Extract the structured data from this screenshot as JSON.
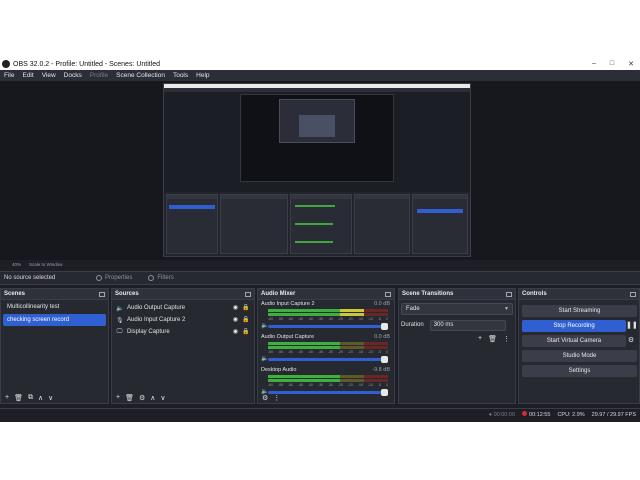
{
  "window": {
    "title": "OBS 32.0.2 - Profile: Untitled - Scenes: Untitled",
    "controls": [
      "–",
      "□",
      "✕"
    ]
  },
  "menu": [
    "File",
    "Edit",
    "View",
    "Docks",
    "Profile",
    "Scene Collection",
    "Tools",
    "Help"
  ],
  "zoom": {
    "percent": "40%",
    "mode": "Scale to Window"
  },
  "source_bar": {
    "no_source": "No source selected",
    "properties": "Properties",
    "filters": "Filters"
  },
  "scenes": {
    "title": "Scenes",
    "items": [
      {
        "label": "Multicollinearity test"
      },
      {
        "label": "checking screen record"
      }
    ],
    "footer": [
      "+",
      "🗑",
      "⧉",
      "∧",
      "∨"
    ]
  },
  "sources": {
    "title": "Sources",
    "items": [
      {
        "label": "Audio Output Capture",
        "icon": "🔈"
      },
      {
        "label": "Audio Input Capture 2",
        "icon": "🎙"
      },
      {
        "label": "Display Capture",
        "icon": "🖵"
      }
    ],
    "footer": [
      "+",
      "🗑",
      "⚙",
      "∧",
      "∨"
    ]
  },
  "mixer": {
    "title": "Audio Mixer",
    "scale": [
      "-60",
      "-55",
      "-50",
      "-45",
      "-40",
      "-35",
      "-30",
      "-25",
      "-20",
      "-15",
      "-10",
      "-5",
      "0"
    ],
    "channels": [
      {
        "name": "Audio Input Capture 2",
        "db": "0.0 dB",
        "level": 0.62
      },
      {
        "name": "Audio Output Capture",
        "db": "0.0 dB",
        "level": 0.6
      },
      {
        "name": "Desktop Audio",
        "db": "-9.8 dB",
        "level": 0.6
      }
    ],
    "footer": [
      "⚙",
      "⋮"
    ]
  },
  "transitions": {
    "title": "Scene Transitions",
    "selected": "Fade",
    "duration_label": "Duration",
    "duration_value": "300 ms",
    "tools": [
      "+",
      "🗑",
      "⋮"
    ]
  },
  "controls": {
    "title": "Controls",
    "start_streaming": "Start Streaming",
    "stop_recording": "Stop Recording",
    "pause_icon": "❚❚",
    "start_virtual_camera": "Start Virtual Camera",
    "camera_settings_icon": "⚙",
    "studio_mode": "Studio Mode",
    "settings": "Settings"
  },
  "status": {
    "stream_time": "00:00:00",
    "rec_time": "00:12:55",
    "cpu": "CPU: 2.9%",
    "fps": "29.97 / 29.97 FPS"
  },
  "colors": {
    "accent": "#2f5fd0",
    "rec": "#d13030",
    "meter_green": "#3eb03e"
  }
}
